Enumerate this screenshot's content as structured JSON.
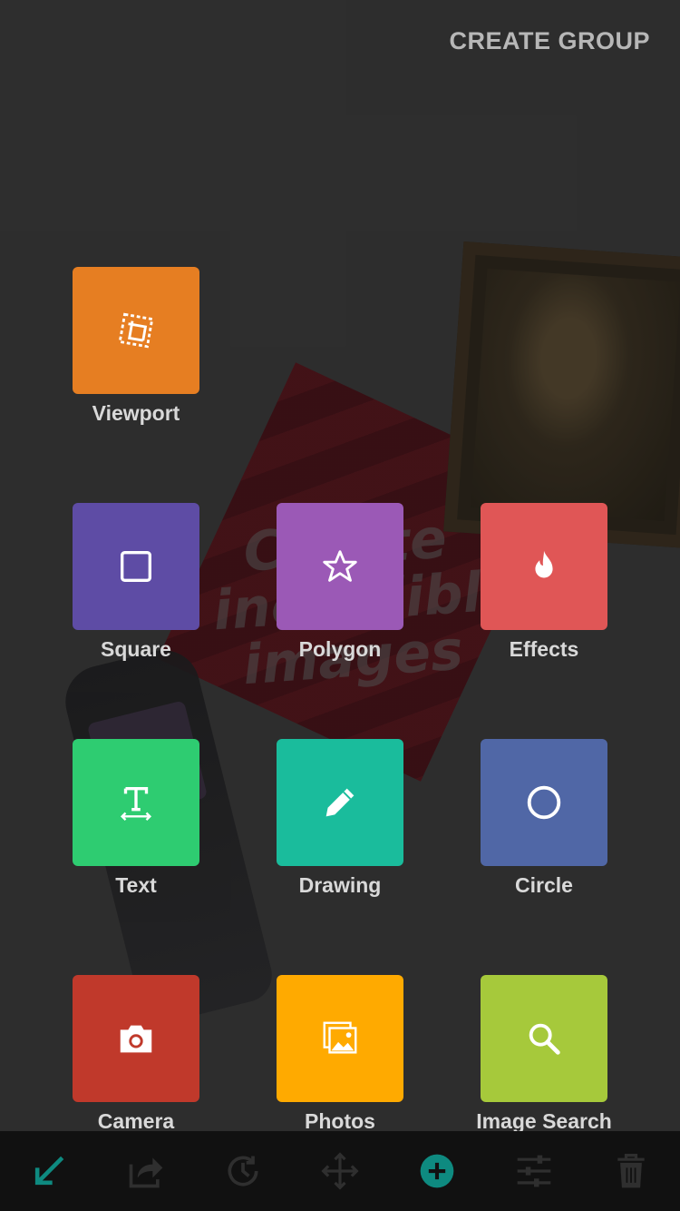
{
  "header": {
    "create_group_label": "CREATE GROUP"
  },
  "tiles": [
    {
      "label": "Viewport",
      "color": "#e67e22",
      "icon": "viewport-crop-icon"
    },
    {
      "label": "Square",
      "color": "#5e4ca5",
      "icon": "square-icon"
    },
    {
      "label": "Polygon",
      "color": "#9b59b6",
      "icon": "star-icon"
    },
    {
      "label": "Effects",
      "color": "#e05656",
      "icon": "flame-icon"
    },
    {
      "label": "Text",
      "color": "#2ecc71",
      "icon": "text-icon"
    },
    {
      "label": "Drawing",
      "color": "#1abc9c",
      "icon": "pencil-icon"
    },
    {
      "label": "Circle",
      "color": "#5067a6",
      "icon": "circle-icon"
    },
    {
      "label": "Camera",
      "color": "#c0392b",
      "icon": "camera-icon"
    },
    {
      "label": "Photos",
      "color": "#ffaa00",
      "icon": "photos-icon"
    },
    {
      "label": "Image Search",
      "color": "#a6c93b",
      "icon": "search-icon"
    }
  ],
  "toolbar": {
    "accent": "#0e8a80",
    "icons": [
      "arrow-down-left-icon",
      "share-icon",
      "history-icon",
      "move-icon",
      "add-icon",
      "sliders-icon",
      "trash-icon"
    ]
  }
}
